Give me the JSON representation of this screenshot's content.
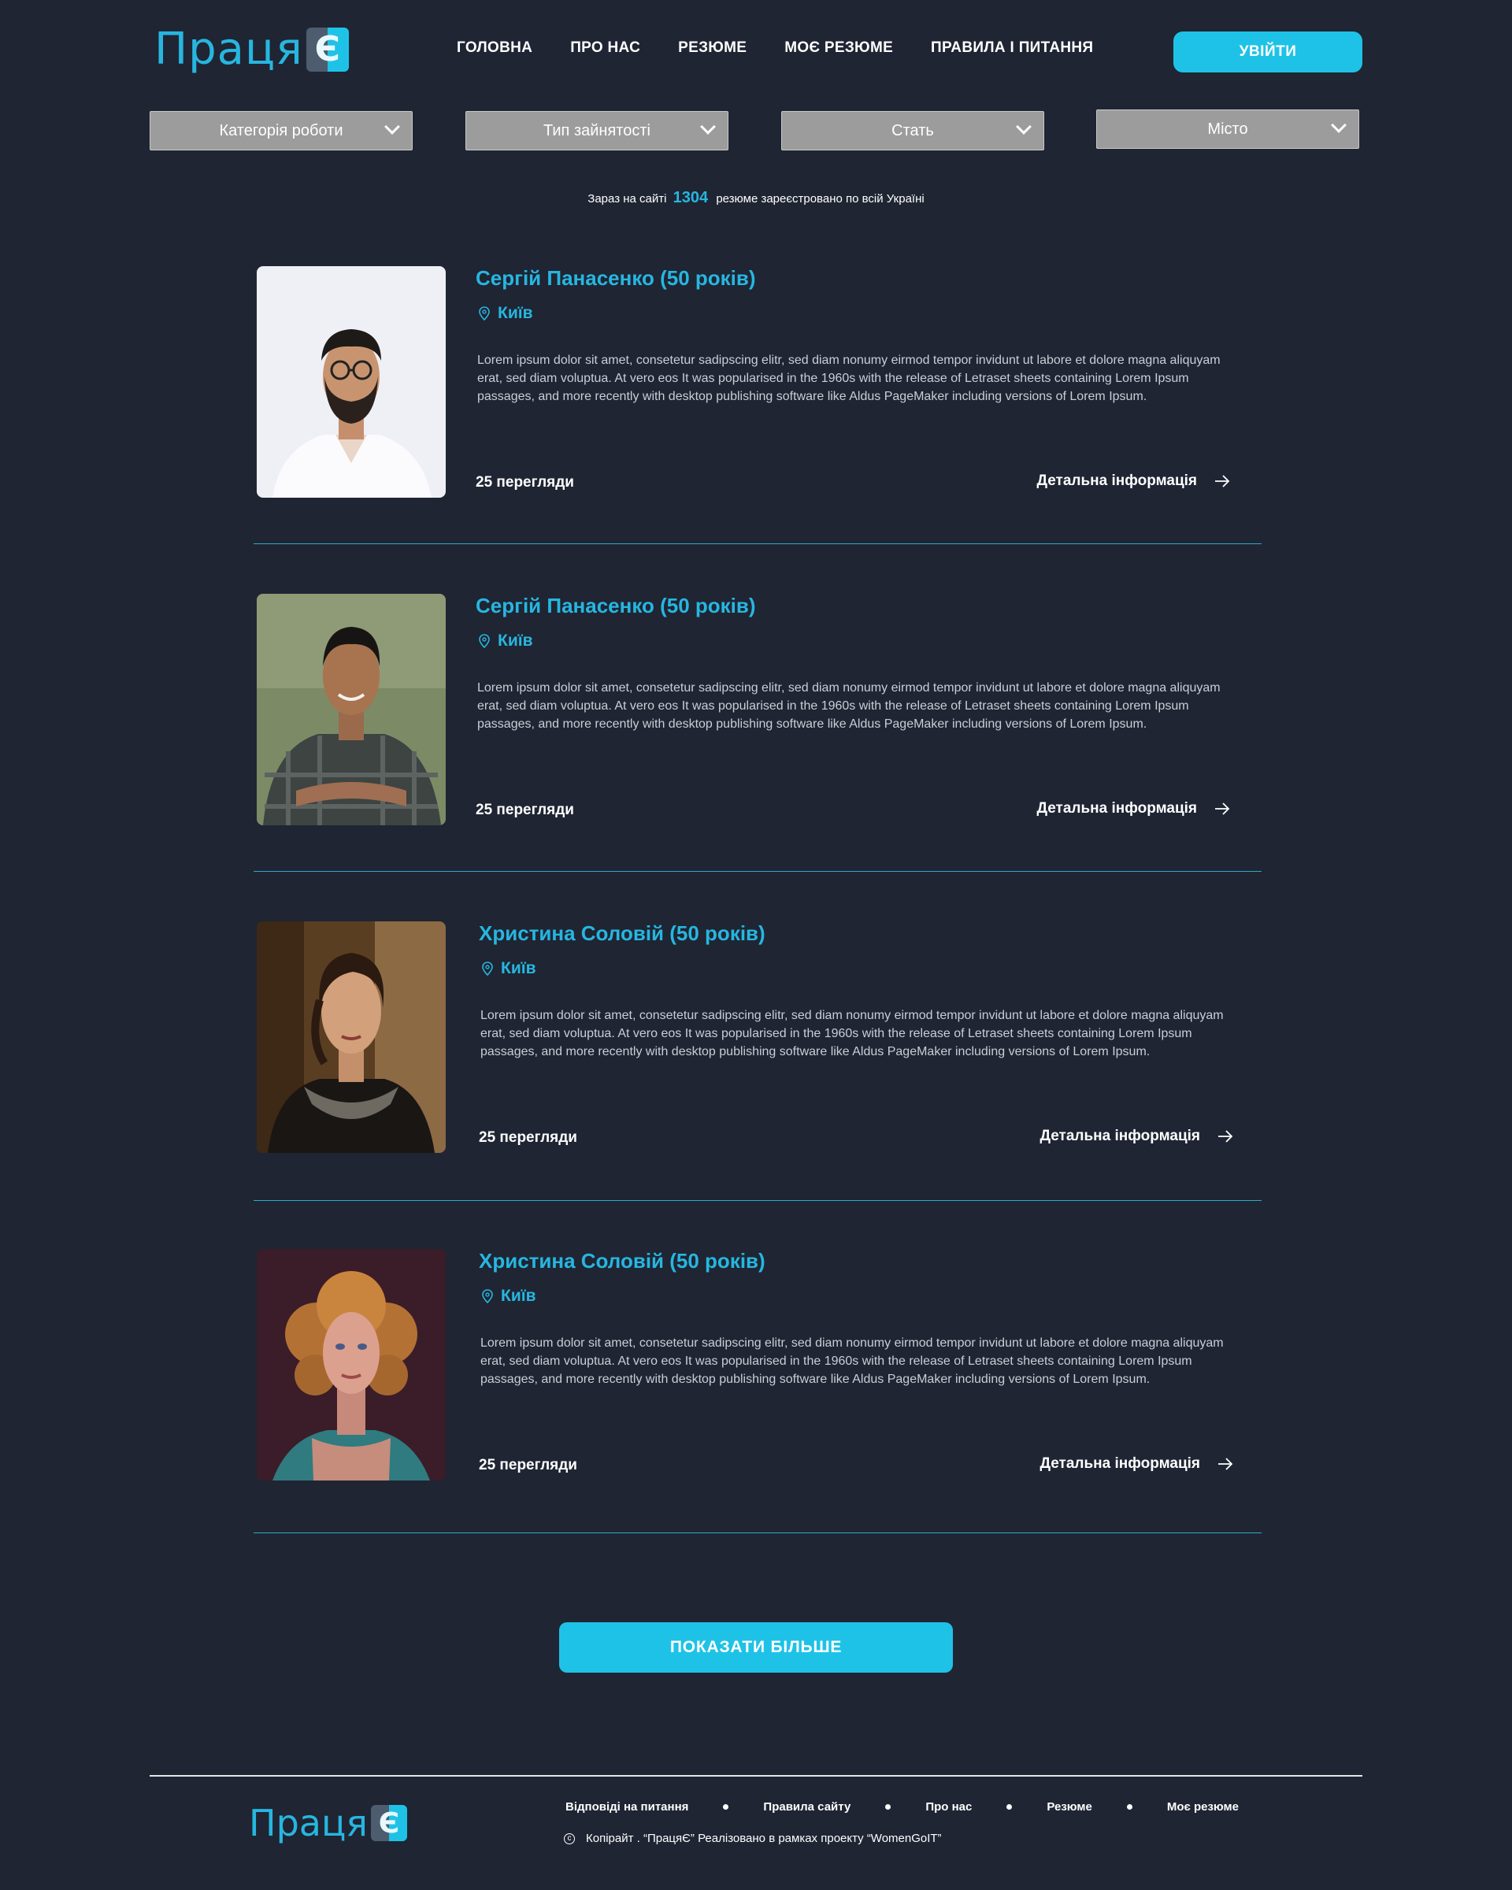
{
  "brand": {
    "name": "Праця",
    "mark_letter": "Є"
  },
  "colors": {
    "accent": "#1fc2e7",
    "background": "#1f2533",
    "filter_bg": "#9c9c9c",
    "text_muted": "#c9ced6"
  },
  "nav": {
    "items": [
      "ГОЛОВНА",
      "ПРО НАС",
      "РЕЗЮМЕ",
      "МОЄ РЕЗЮМЕ",
      "ПРАВИЛА І ПИТАННЯ"
    ],
    "login_label": "УВІЙТИ"
  },
  "filters": [
    "Категорія роботи",
    "Тип зайнятості",
    "Стать",
    "Місто"
  ],
  "stats": {
    "prefix": "Зараз на сайті",
    "count": "1304",
    "suffix": "резюме зареєстровано  по всій Україні"
  },
  "resumes": [
    {
      "name": "Сергій Панасенко (50 років)",
      "city": "Київ",
      "description": "Lorem ipsum dolor sit amet, consetetur sadipscing elitr, sed diam nonumy eirmod tempor invidunt ut labore et dolore magna aliquyam erat, sed diam voluptua. At vero eos  It was popularised in the 1960s with the release of Letraset sheets containing Lorem Ipsum passages, and more recently with desktop publishing software like Aldus PageMaker including versions of Lorem Ipsum.",
      "views": "25 перегляди",
      "details_label": "Детальна інформація"
    },
    {
      "name": "Сергій Панасенко (50 років)",
      "city": "Київ",
      "description": "Lorem ipsum dolor sit amet, consetetur sadipscing elitr, sed diam nonumy eirmod tempor invidunt ut labore et dolore magna aliquyam erat, sed diam voluptua. At vero eos  It was popularised in the 1960s with the release of Letraset sheets containing Lorem Ipsum passages, and more recently with desktop publishing software like Aldus PageMaker including versions of Lorem Ipsum.",
      "views": "25 перегляди",
      "details_label": "Детальна інформація"
    },
    {
      "name": "Христина Соловій (50 років)",
      "city": "Київ",
      "description": "Lorem ipsum dolor sit amet, consetetur sadipscing elitr, sed diam nonumy eirmod tempor invidunt ut labore et dolore magna aliquyam erat, sed diam voluptua. At vero eos  It was popularised in the 1960s with the release of Letraset sheets containing Lorem Ipsum passages, and more recently with desktop publishing software like Aldus PageMaker including versions of Lorem Ipsum.",
      "views": "25 перегляди",
      "details_label": "Детальна інформація"
    },
    {
      "name": "Христина Соловій (50 років)",
      "city": "Київ",
      "description": "Lorem ipsum dolor sit amet, consetetur sadipscing elitr, sed diam nonumy eirmod tempor invidunt ut labore et dolore magna aliquyam erat, sed diam voluptua. At vero eos  It was popularised in the 1960s with the release of Letraset sheets containing Lorem Ipsum passages, and more recently with desktop publishing software like Aldus PageMaker including versions of Lorem Ipsum.",
      "views": "25 перегляди",
      "details_label": "Детальна інформація"
    }
  ],
  "show_more_label": "ПОКАЗАТИ БІЛЬШЕ",
  "footer": {
    "links": [
      "Відповіді на питання",
      "Правила сайту",
      "Про нас",
      "Резюме",
      "Моє резюме"
    ],
    "copyright": "Копірайт . “ПрацяЄ” Реалізовано в рамках проекту “WomenGoIT”"
  },
  "icons": {
    "location": "map-pin-icon",
    "details_arrow": "arrow-right-icon",
    "filter_chevron": "chevron-down-icon",
    "copyright": "copyright-icon"
  }
}
